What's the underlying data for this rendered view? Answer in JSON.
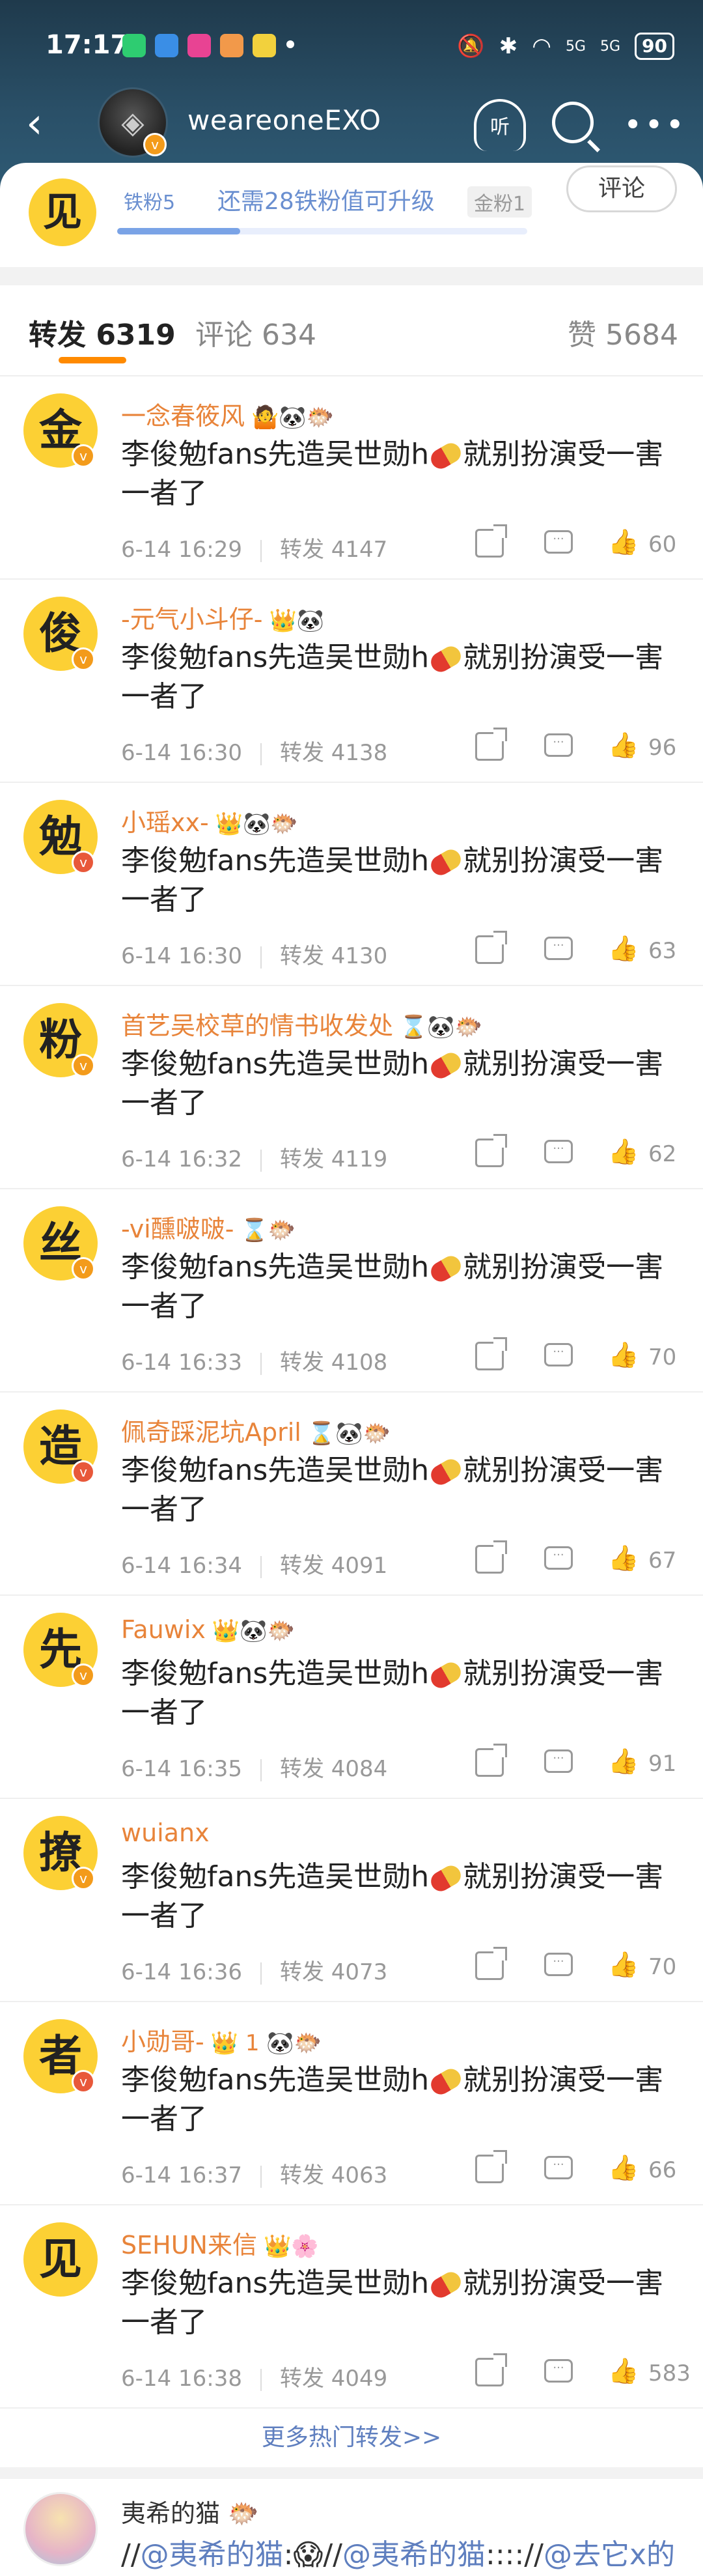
{
  "status_bar": {
    "time": "17:17",
    "battery": "90",
    "signal1": "5G",
    "signal2": "5G"
  },
  "nav": {
    "title": "weareoneEXO",
    "listen_label": "听"
  },
  "fan": {
    "badge_char": "见",
    "level": "铁粉5",
    "upgrade_text": "还需28铁粉值可升级",
    "next_level": "金粉1",
    "progress": 0.3,
    "comment_button": "评论"
  },
  "tabs": {
    "reposts": "转发 6319",
    "comments": "评论 634",
    "likes": "赞 5684"
  },
  "items": [
    {
      "avatar": "金",
      "name": "一念春筱风",
      "emoji": "🤷🐼🐡",
      "text_pre": "李俊勉fans先造吴世勋h",
      "text_post": "就别扮演受一害一者了",
      "time": "6-14 16:29",
      "repost": "转发 4147",
      "likes": "60",
      "vcolor": "#f39b1b"
    },
    {
      "avatar": "俊",
      "name": "-元气小斗仔-",
      "emoji": "👑🐼",
      "text_pre": "李俊勉fans先造吴世勋h",
      "text_post": "就别扮演受一害一者了",
      "time": "6-14 16:30",
      "repost": "转发 4138",
      "likes": "96",
      "vcolor": "#f39b1b"
    },
    {
      "avatar": "勉",
      "name": "小瑶xx-",
      "emoji": "👑🐼🐡",
      "text_pre": "李俊勉fans先造吴世勋h",
      "text_post": "就别扮演受一害一者了",
      "time": "6-14 16:30",
      "repost": "转发 4130",
      "likes": "63",
      "vcolor": "#e8583a"
    },
    {
      "avatar": "粉",
      "name": "首艺吴校草的情书收发处",
      "emoji": "⌛🐼🐡",
      "text_pre": "李俊勉fans先造吴世勋h",
      "text_post": "就别扮演受一害一者了",
      "time": "6-14 16:32",
      "repost": "转发 4119",
      "likes": "62",
      "vcolor": "#f39b1b"
    },
    {
      "avatar": "丝",
      "name": "-vi醺啵啵-",
      "emoji": "⌛🐡",
      "text_pre": "李俊勉fans先造吴世勋h",
      "text_post": "就别扮演受一害一者了",
      "time": "6-14 16:33",
      "repost": "转发 4108",
      "likes": "70",
      "vcolor": "#f39b1b"
    },
    {
      "avatar": "造",
      "name": "佩奇踩泥坑April",
      "emoji": "⌛🐼🐡",
      "text_pre": "李俊勉fans先造吴世勋h",
      "text_post": "就别扮演受一害一者了",
      "time": "6-14 16:34",
      "repost": "转发 4091",
      "likes": "67",
      "vcolor": "#e8583a"
    },
    {
      "avatar": "先",
      "name": "Fauwix",
      "emoji": "👑🐼🐡",
      "text_pre": "李俊勉fans先造吴世勋h",
      "text_post": "就别扮演受一害一者了",
      "time": "6-14 16:35",
      "repost": "转发 4084",
      "likes": "91",
      "vcolor": "#f39b1b"
    },
    {
      "avatar": "撩",
      "name": "wuianx",
      "emoji": "",
      "text_pre": "李俊勉fans先造吴世勋h",
      "text_post": "就别扮演受一害一者了",
      "time": "6-14 16:36",
      "repost": "转发 4073",
      "likes": "70",
      "vcolor": "#f39b1b"
    },
    {
      "avatar": "者",
      "name": "小勋哥-",
      "emoji": "👑 1 🐼🐡",
      "text_pre": "李俊勉fans先造吴世勋h",
      "text_post": "就别扮演受一害一者了",
      "time": "6-14 16:37",
      "repost": "转发 4063",
      "likes": "66",
      "vcolor": "#e8583a"
    },
    {
      "avatar": "见",
      "name": "SEHUN来信",
      "emoji": "👑🌸",
      "text_pre": "李俊勉fans先造吴世勋h",
      "text_post": "就别扮演受一害一者了",
      "time": "6-14 16:38",
      "repost": "转发 4049",
      "likes": "583",
      "vcolor": ""
    }
  ],
  "more_hot_reposts": "更多热门转发>>",
  "bottom_item": {
    "name": "夷希的猫",
    "emoji": "🐡",
    "text_a": "//",
    "mention_a": "@夷希的猫",
    "text_b": ":😱//",
    "mention_b": "@夷希的猫",
    "text_c": ":::://",
    "mention_c": "@去它x的"
  },
  "colors": {
    "accent": "#ff8a00",
    "name": "#e8843a",
    "mention": "#5f7fbf",
    "avatar_bg": "#fcd034"
  },
  "icons": [
    "back-icon",
    "listen-icon",
    "search-icon",
    "more-icon",
    "share-icon",
    "comment-icon",
    "like-icon"
  ]
}
